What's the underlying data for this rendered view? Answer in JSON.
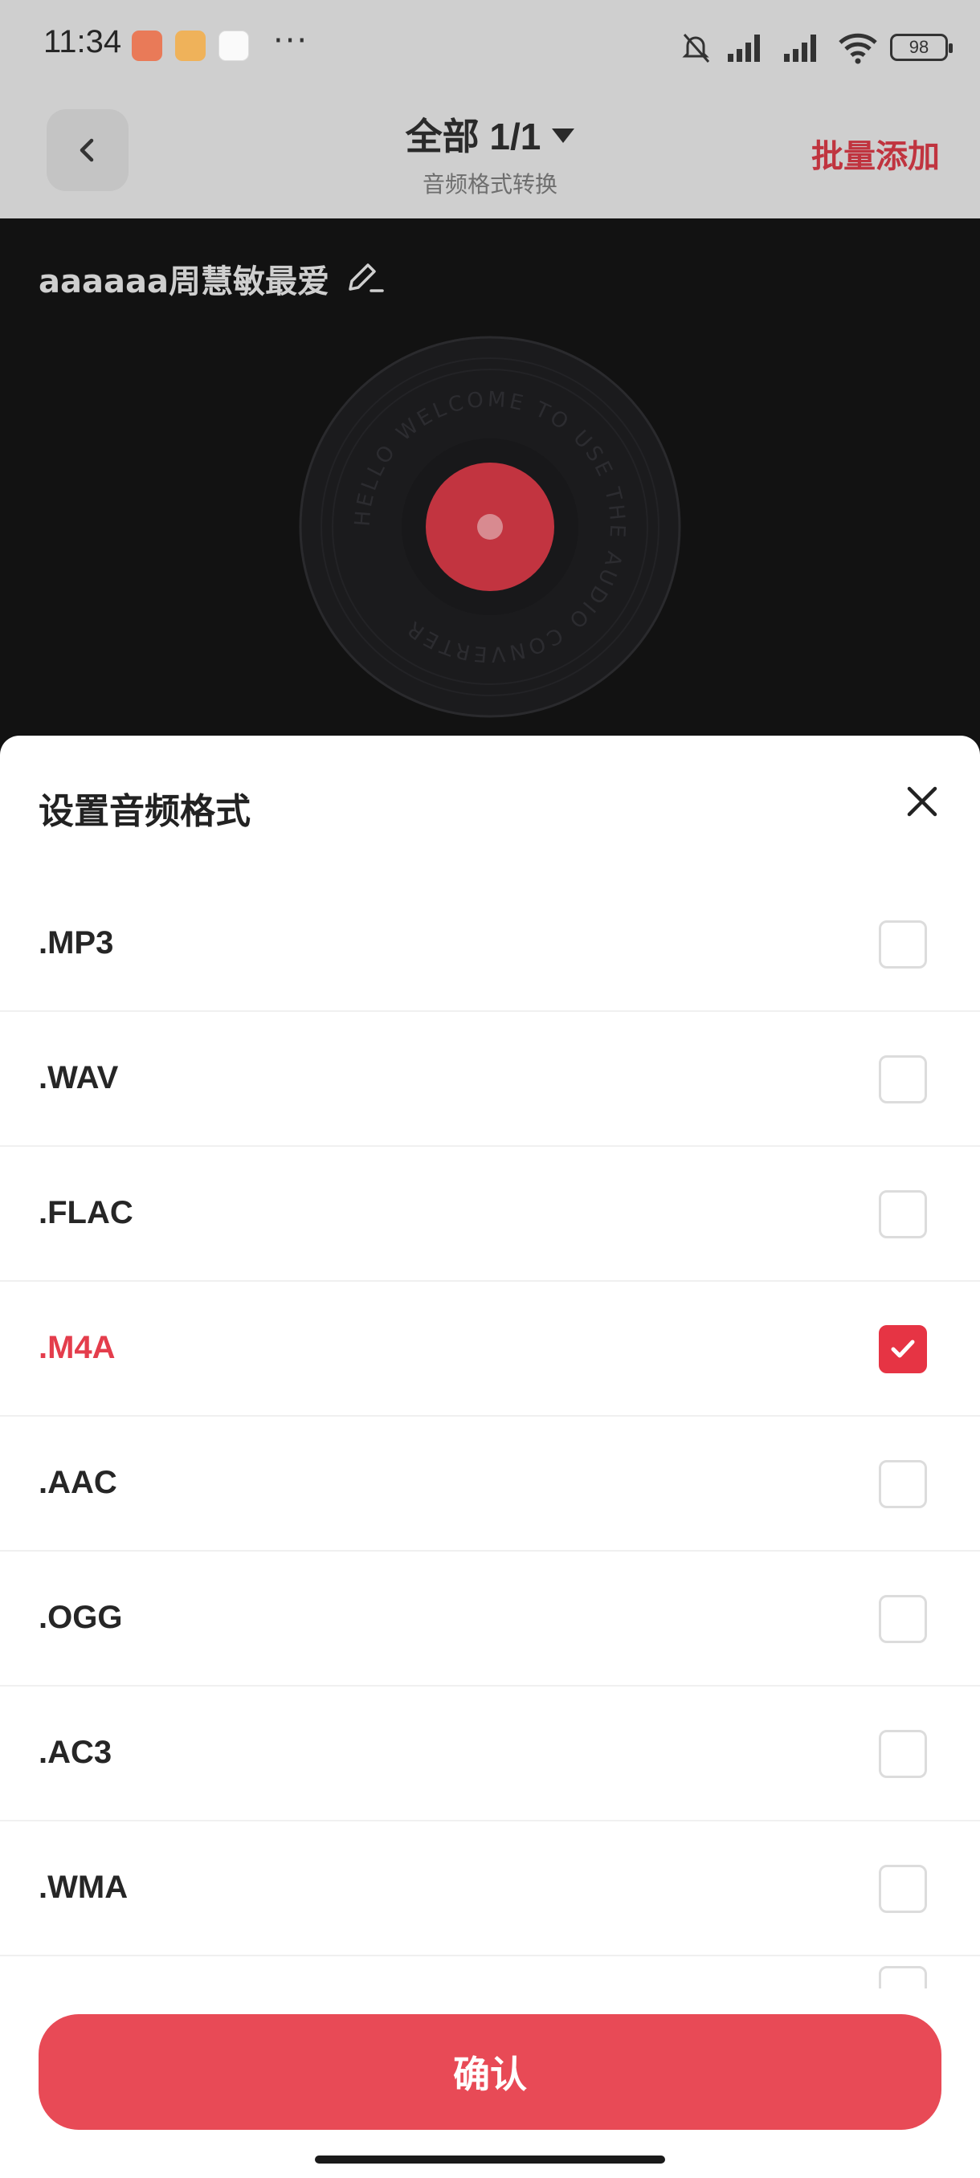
{
  "status_bar": {
    "time": "11:34",
    "dots": "···",
    "battery": "98"
  },
  "header": {
    "title": "全部 1/1",
    "subtitle": "音频格式转换",
    "batch_add": "批量添加"
  },
  "file": {
    "name": "aaaaaa周慧敏最爱"
  },
  "vinyl": {
    "ring_text": "HELLO WELCOME TO USE THE AUDIO CONVERTER"
  },
  "sheet": {
    "title": "设置音频格式",
    "formats": [
      {
        "label": ".MP3",
        "checked": false
      },
      {
        "label": ".WAV",
        "checked": false
      },
      {
        "label": ".FLAC",
        "checked": false
      },
      {
        "label": ".M4A",
        "checked": true
      },
      {
        "label": ".AAC",
        "checked": false
      },
      {
        "label": ".OGG",
        "checked": false
      },
      {
        "label": ".AC3",
        "checked": false
      },
      {
        "label": ".WMA",
        "checked": false
      }
    ],
    "confirm_label": "确认"
  },
  "colors": {
    "accent": "#e84a56",
    "selected_text": "#e43d4c",
    "checkbox_border": "#dcdcdc"
  }
}
